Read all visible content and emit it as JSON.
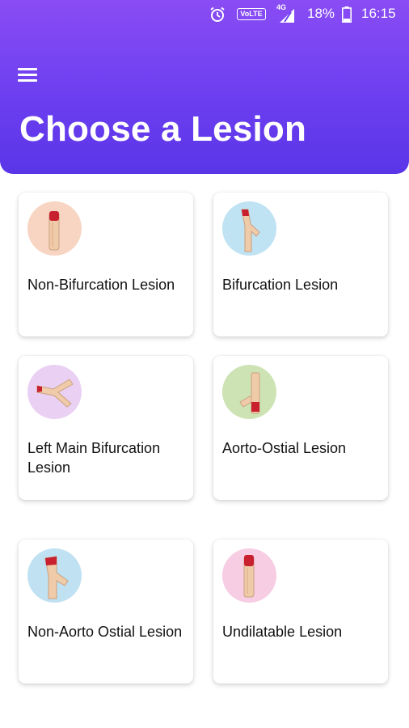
{
  "status_bar": {
    "network_badge": "VoLTE",
    "network_type": "4G",
    "battery": "18%",
    "time": "16:15",
    "icons": [
      "alarm-icon",
      "volte-icon",
      "signal-icon",
      "battery-icon"
    ]
  },
  "header": {
    "title": "Choose a Lesion",
    "menu_icon": "hamburger-menu-icon",
    "gradient_colors": [
      "#8a4cf4",
      "#5a35e8"
    ]
  },
  "lesions": [
    {
      "label": "Non-Bifurcation Lesion",
      "icon": "straight-vessel-icon",
      "icon_bg": "#f7d5c2"
    },
    {
      "label": "Bifurcation Lesion",
      "icon": "bifurcation-vessel-icon",
      "icon_bg": "#bfe3f3"
    },
    {
      "label": "Left Main Bifurcation Lesion",
      "icon": "left-main-vessel-icon",
      "icon_bg": "#ead1f3"
    },
    {
      "label": "Aorto-Ostial Lesion",
      "icon": "aorto-ostial-vessel-icon",
      "icon_bg": "#cde3b4"
    },
    {
      "label": "Non-Aorto Ostial Lesion",
      "icon": "non-aorto-ostial-vessel-icon",
      "icon_bg": "#bfe1f2"
    },
    {
      "label": "Undilatable Lesion",
      "icon": "undilatable-vessel-icon",
      "icon_bg": "#f6cde2"
    }
  ]
}
